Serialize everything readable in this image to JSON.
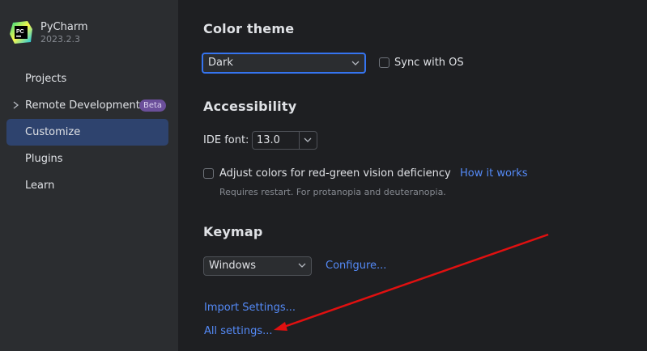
{
  "app": {
    "name": "PyCharm",
    "version": "2023.2.3",
    "logo_text": "PC"
  },
  "sidebar": {
    "items": [
      {
        "label": "Projects",
        "active": false
      },
      {
        "label": "Remote Development",
        "active": false,
        "badge": "Beta",
        "expandable": true
      },
      {
        "label": "Customize",
        "active": true
      },
      {
        "label": "Plugins",
        "active": false
      },
      {
        "label": "Learn",
        "active": false
      }
    ]
  },
  "color_theme": {
    "title": "Color theme",
    "selected": "Dark",
    "sync_label": "Sync with OS",
    "sync_checked": false
  },
  "accessibility": {
    "title": "Accessibility",
    "ide_font_label": "IDE font:",
    "ide_font_value": "13.0",
    "adjust_colors_label": "Adjust colors for red-green vision deficiency",
    "adjust_colors_checked": false,
    "how_it_works": "How it works",
    "hint": "Requires restart. For protanopia and deuteranopia."
  },
  "keymap": {
    "title": "Keymap",
    "selected": "Windows",
    "configure": "Configure..."
  },
  "links": {
    "import_settings": "Import Settings...",
    "all_settings": "All settings..."
  },
  "colors": {
    "accent": "#3574f0",
    "link": "#548af7",
    "active_nav": "#2e436e",
    "annotation_arrow": "#e01010"
  }
}
